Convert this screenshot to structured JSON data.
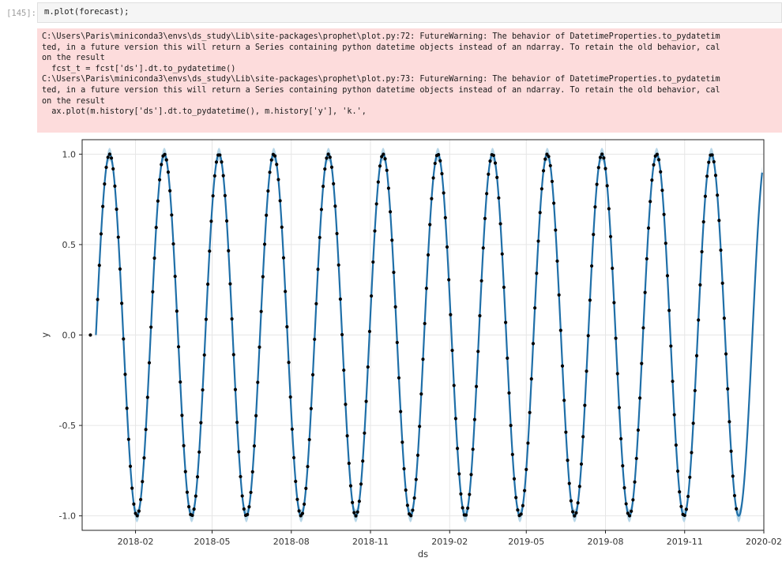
{
  "cell": {
    "prompt": "[145]:",
    "code": "m.plot(forecast);"
  },
  "stderr": {
    "lines": [
      "C:\\Users\\Paris\\miniconda3\\envs\\ds_study\\Lib\\site-packages\\prophet\\plot.py:72: FutureWarning: The behavior of DatetimeProperties.to_pydatetim",
      "ted, in a future version this will return a Series containing python datetime objects instead of an ndarray. To retain the old behavior, cal",
      "on the result",
      "  fcst_t = fcst['ds'].dt.to_pydatetime()",
      "C:\\Users\\Paris\\miniconda3\\envs\\ds_study\\Lib\\site-packages\\prophet\\plot.py:73: FutureWarning: The behavior of DatetimeProperties.to_pydatetim",
      "ted, in a future version this will return a Series containing python datetime objects instead of an ndarray. To retain the old behavior, cal",
      "on the result",
      "  ax.plot(m.history['ds'].dt.to_pydatetime(), m.history['y'], 'k.',"
    ]
  },
  "chart_data": {
    "type": "line",
    "xlabel": "ds",
    "ylabel": "y",
    "x_range": [
      "2017-12-01",
      "2020-02-01"
    ],
    "ylim": [
      -1.08,
      1.08
    ],
    "x_ticks": [
      "2018-02",
      "2018-05",
      "2018-08",
      "2018-11",
      "2019-02",
      "2019-05",
      "2019-08",
      "2019-11",
      "2020-02"
    ],
    "y_ticks": [
      1.0,
      0.5,
      0.0,
      -0.5,
      -1.0
    ],
    "y_tick_labels": [
      "1.0",
      "0.5",
      "0.0",
      "-0.5",
      "-1.0"
    ],
    "grid": true,
    "history": {
      "start": "2017-12-17",
      "end": "2019-12-31",
      "frequency": "every 2 days",
      "function": "y = sin(2*pi*t/63.56) where t = days since 2017-12-17",
      "first_point_y": 0.0,
      "marker": "black dots"
    },
    "forecast": {
      "start": "2017-12-17",
      "end": "2020-01-30",
      "line_color": "#1f6fa8",
      "band_color": "#a9cfe4",
      "band_half_width": 0.035
    }
  }
}
